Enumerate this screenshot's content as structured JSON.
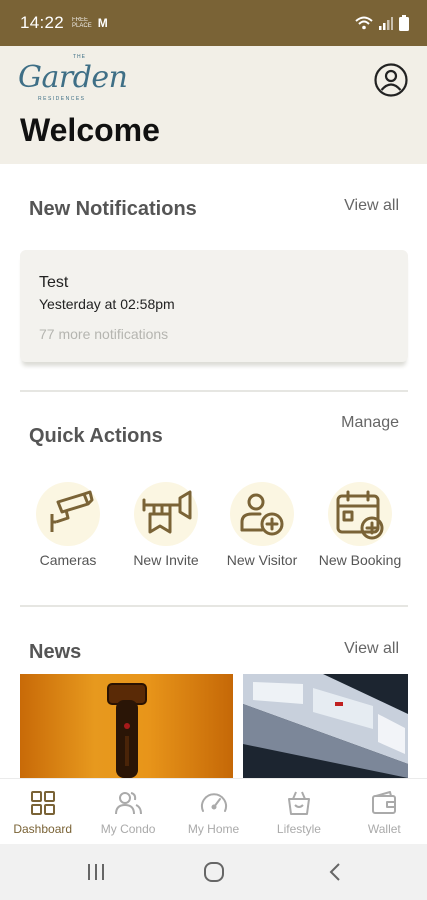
{
  "status": {
    "time": "14:22",
    "mini_top": "FREE",
    "mini_bottom": "PLACE",
    "mm": "M"
  },
  "header": {
    "logo_the": "THE",
    "logo_script": "Garden",
    "logo_sub": "RESIDENCES",
    "welcome": "Welcome",
    "profile_icon": "profile-icon"
  },
  "notifications": {
    "title": "New Notifications",
    "view_all": "View all",
    "item_title": "Test",
    "item_time": "Yesterday at 02:58pm",
    "more": "77 more notifications"
  },
  "quick_actions": {
    "title": "Quick Actions",
    "manage": "Manage",
    "items": [
      {
        "label": "Cameras",
        "icon": "camera-icon"
      },
      {
        "label": "New Invite",
        "icon": "trumpet-icon"
      },
      {
        "label": "New Visitor",
        "icon": "add-visitor-icon"
      },
      {
        "label": "New Booking",
        "icon": "add-booking-icon"
      }
    ]
  },
  "news": {
    "title": "News",
    "view_all": "View all"
  },
  "bottom_nav": [
    {
      "label": "Dashboard",
      "icon": "grid-icon",
      "active": true
    },
    {
      "label": "My Condo",
      "icon": "people-icon",
      "active": false
    },
    {
      "label": "My Home",
      "icon": "gauge-icon",
      "active": false
    },
    {
      "label": "Lifestyle",
      "icon": "bag-icon",
      "active": false
    },
    {
      "label": "Wallet",
      "icon": "wallet-icon",
      "active": false
    }
  ],
  "colors": {
    "accent": "#7a6336",
    "header_bg": "#f2efe7",
    "blob": "#fbf6e2"
  }
}
